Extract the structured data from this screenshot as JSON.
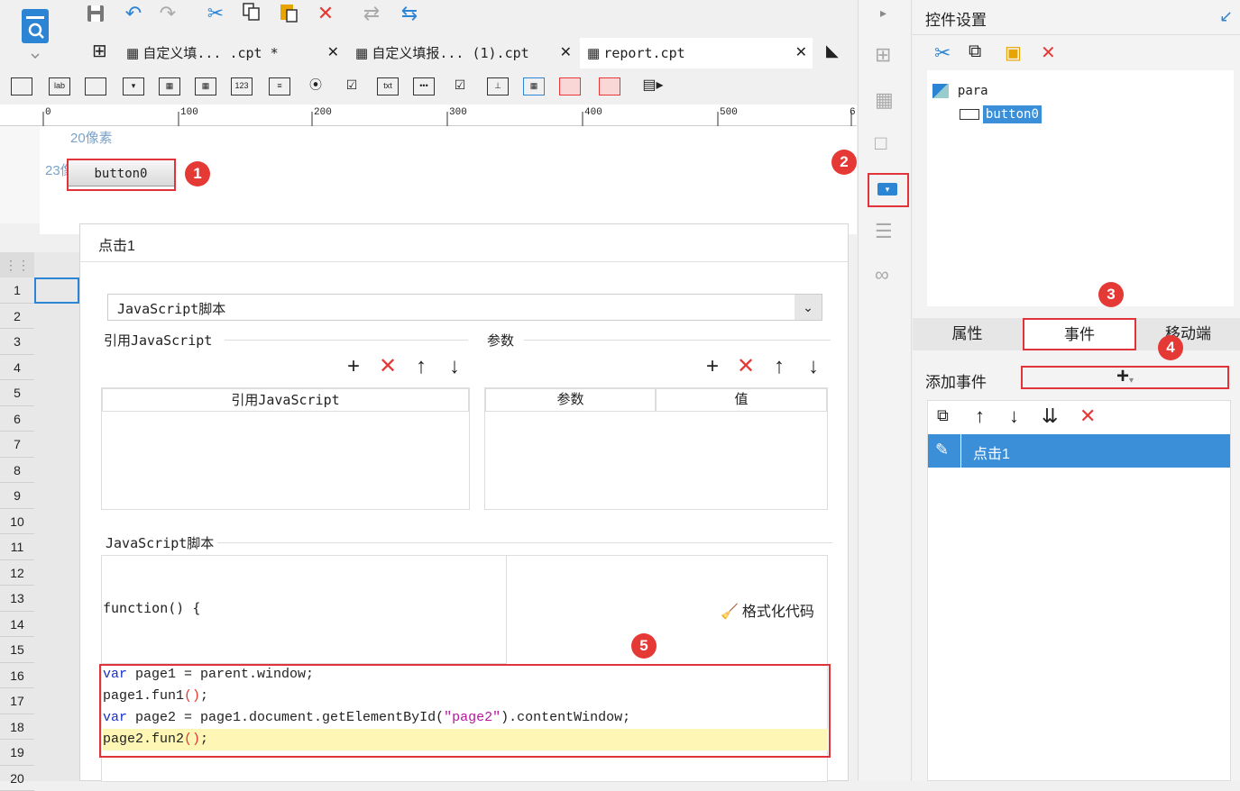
{
  "toolbar": {
    "icons": [
      "save-icon",
      "undo-icon",
      "redo-icon",
      "cut-icon",
      "copy-icon",
      "paste-icon",
      "delete-icon",
      "refresh-icon",
      "swap-icon"
    ]
  },
  "tabs": [
    {
      "label": "自定义填... .cpt *"
    },
    {
      "label": "自定义填报... (1).cpt"
    },
    {
      "label": "report.cpt"
    }
  ],
  "ruler": {
    "ticks": [
      "0",
      "100",
      "200",
      "300",
      "400",
      "500",
      "6"
    ]
  },
  "canvas": {
    "dim_top": "20像素",
    "dim_left": "23像素",
    "button_label": "button0"
  },
  "grid": {
    "rows": [
      "1",
      "2",
      "3",
      "4",
      "5",
      "6",
      "7",
      "8",
      "9",
      "10",
      "11",
      "12",
      "13",
      "14",
      "15",
      "16",
      "17",
      "18",
      "19",
      "20"
    ]
  },
  "dialog": {
    "title": "点击1",
    "type_select": "JavaScript脚本",
    "ref_js_section": "引用JavaScript",
    "params_section": "参数",
    "ref_js_header": "引用JavaScript",
    "param_header": "参数",
    "value_header": "值",
    "script_section": "JavaScript脚本",
    "function_text": "function() {",
    "format_code": "格式化代码",
    "code": {
      "line1_kw": "var",
      "line1_rest": " page1 = parent.window;",
      "line2": "page1.fun1",
      "line3_kw": "var",
      "line3_mid": " page2 = page1.document.getElementById(",
      "line3_str": "\"page2\"",
      "line3_end": ").contentWindow;",
      "line4": "page2.fun2"
    }
  },
  "right_panel": {
    "title": "控件设置",
    "tree_root": "para",
    "tree_child": "button0",
    "tabs": [
      "属性",
      "事件",
      "移动端"
    ],
    "add_event_label": "添加事件",
    "add_event_value": "+",
    "event_item": "点击1"
  },
  "badges": [
    "1",
    "2",
    "3",
    "4",
    "5"
  ],
  "colors": {
    "accent": "#3b8fd9",
    "highlight_red": "#e0343a",
    "selection_blue": "#3b8fd9",
    "code_highlight": "#fdf6b4"
  }
}
